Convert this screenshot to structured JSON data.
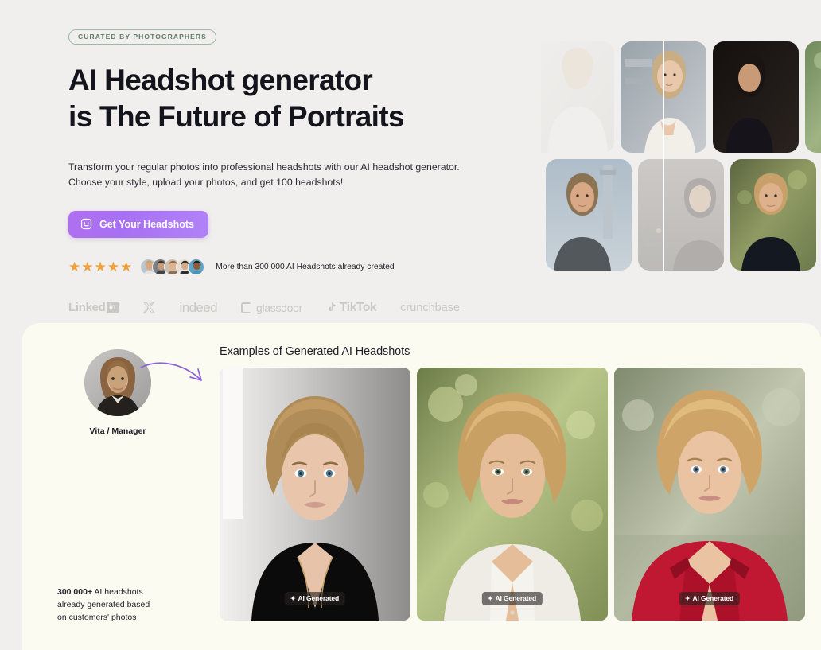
{
  "theme": {
    "page_bg": "#f0efed",
    "card_bg": "#fcfbf2",
    "accent_purple": "#a770f3",
    "star_color": "#f0a037",
    "badge_green": "#5f7d6a",
    "text_dark": "#14141c"
  },
  "hero": {
    "eyebrow": "CURATED BY PHOTOGRAPHERS",
    "title_line1": "AI Headshot generator",
    "title_line2": "is The Future of Portraits",
    "sub_line1": "Transform your regular photos into professional headshots with our AI headshot generator.",
    "sub_line2": "Choose your style, upload your photos, and get 100 headshots!",
    "cta_label": "Get Your Headshots",
    "cta_icon": "smiley-face-icon",
    "stars": [
      "★",
      "★",
      "★",
      "★",
      "★"
    ],
    "star_count": 5,
    "proof_text": "More than 300 000 AI Headshots already created",
    "avatars": [
      {
        "name": "reviewer-avatar-1",
        "skin": "#d8a884",
        "hair": "#c9a46a",
        "bg": "#b9c6cf"
      },
      {
        "name": "reviewer-avatar-2",
        "skin": "#c89a78",
        "hair": "#3a3430",
        "bg": "#7b7e82"
      },
      {
        "name": "reviewer-avatar-3",
        "skin": "#e0b290",
        "hair": "#8e6d48",
        "bg": "#cdbfae"
      },
      {
        "name": "reviewer-avatar-4",
        "skin": "#d8ab88",
        "hair": "#33261e",
        "bg": "#e3ded6"
      },
      {
        "name": "reviewer-avatar-5",
        "skin": "#8a5c3c",
        "hair": "#241a14",
        "bg": "#5fa3c4"
      }
    ],
    "logos": [
      {
        "id": "linkedin",
        "label": "Linked",
        "mark": "in"
      },
      {
        "id": "x",
        "label": "𝕏",
        "mark": ""
      },
      {
        "id": "indeed",
        "label": "indeed",
        "mark": ""
      },
      {
        "id": "glassdoor",
        "label": "glassdoor",
        "mark": ""
      },
      {
        "id": "tiktok",
        "label": "TikTok",
        "mark": "♪"
      },
      {
        "id": "crunchbase",
        "label": "crunchbase",
        "mark": ""
      }
    ],
    "gallery": {
      "row1": [
        {
          "name": "hero-photo-woman-white-outfit",
          "faded": true,
          "bg1": "#efeeec",
          "bg2": "#dcd9d4",
          "skin": "#efdfd2",
          "hair": "#e2d3bf",
          "cloth": "#f3f1ee"
        },
        {
          "name": "hero-photo-woman-selfie-tank",
          "faded": false,
          "bg1": "#9aa3ab",
          "bg2": "#c8ccd0",
          "skin": "#e9c7ab",
          "hair": "#c9ae84",
          "cloth": "#f2efe9"
        },
        {
          "name": "hero-photo-man-dark-jacket",
          "faded": false,
          "bg1": "#14100e",
          "bg2": "#2a2320",
          "skin": "#c99a76",
          "hair": "#1a1512",
          "cloth": "#16141a"
        },
        {
          "name": "hero-photo-woman-blonde-bob",
          "faded": false,
          "bg1": "#6f8a5c",
          "bg2": "#9fb383",
          "skin": "#e8bc9a",
          "hair": "#d9bb82",
          "cloth": "#e8e6e2"
        },
        {
          "name": "hero-photo-partial-right",
          "faded": false,
          "bg1": "#c9cdd2",
          "bg2": "#dfe2e5",
          "skin": "#e3bb9c",
          "hair": "#b59468",
          "cloth": "#f0eeea"
        }
      ],
      "row2": [
        {
          "name": "hero-photo-man-blue-sky",
          "faded": false,
          "bg1": "#aebdc9",
          "bg2": "#c9d2d8",
          "skin": "#d9a987",
          "hair": "#8b7352",
          "cloth": "#53585c"
        },
        {
          "name": "hero-photo-man-night-city",
          "faded": true,
          "bg1": "#8b8480",
          "bg2": "#5e5955",
          "skin": "#c9a183",
          "hair": "#3b3430",
          "cloth": "#3a3632"
        },
        {
          "name": "hero-photo-man-black-hoodie",
          "faded": false,
          "bg1": "#5c6640",
          "bg2": "#8f9a63",
          "skin": "#ddb18b",
          "hair": "#c9a06a",
          "cloth": "#141821"
        },
        {
          "name": "hero-photo-man-white-sweater",
          "faded": false,
          "bg1": "#6c7a5e",
          "bg2": "#a8b193",
          "skin": "#ddb48e",
          "hair": "#bb9763",
          "cloth": "#f0eeea"
        }
      ]
    }
  },
  "examples": {
    "title": "Examples of Generated AI Headshots",
    "persona": {
      "name_label": "Vita / Manager",
      "photo_name": "persona-source-photo"
    },
    "arrow_name": "curved-arrow-icon",
    "badge_text": "AI Generated",
    "badge_spark": "✦",
    "cards": [
      {
        "name": "example-headshot-black-blouse",
        "bg1": "#ececea",
        "bg2": "#9b9a98",
        "skin": "#e9c6ab",
        "hair": "#b08c58",
        "cloth": "#0b0b0c"
      },
      {
        "name": "example-headshot-white-shirt",
        "bg1": "#7f9152",
        "bg2": "#c3cf8c",
        "skin": "#e5bd98",
        "hair": "#c9a063",
        "cloth": "#efece6"
      },
      {
        "name": "example-headshot-red-blazer",
        "bg1": "#7c8a6f",
        "bg2": "#b6bda4",
        "skin": "#e9c3a2",
        "hair": "#cfa468",
        "cloth": "#c01832"
      }
    ],
    "stats": {
      "number": "300 000+",
      "line1_rest": " AI headshots",
      "line2": "already generated based",
      "line3": "on customers' photos"
    }
  }
}
